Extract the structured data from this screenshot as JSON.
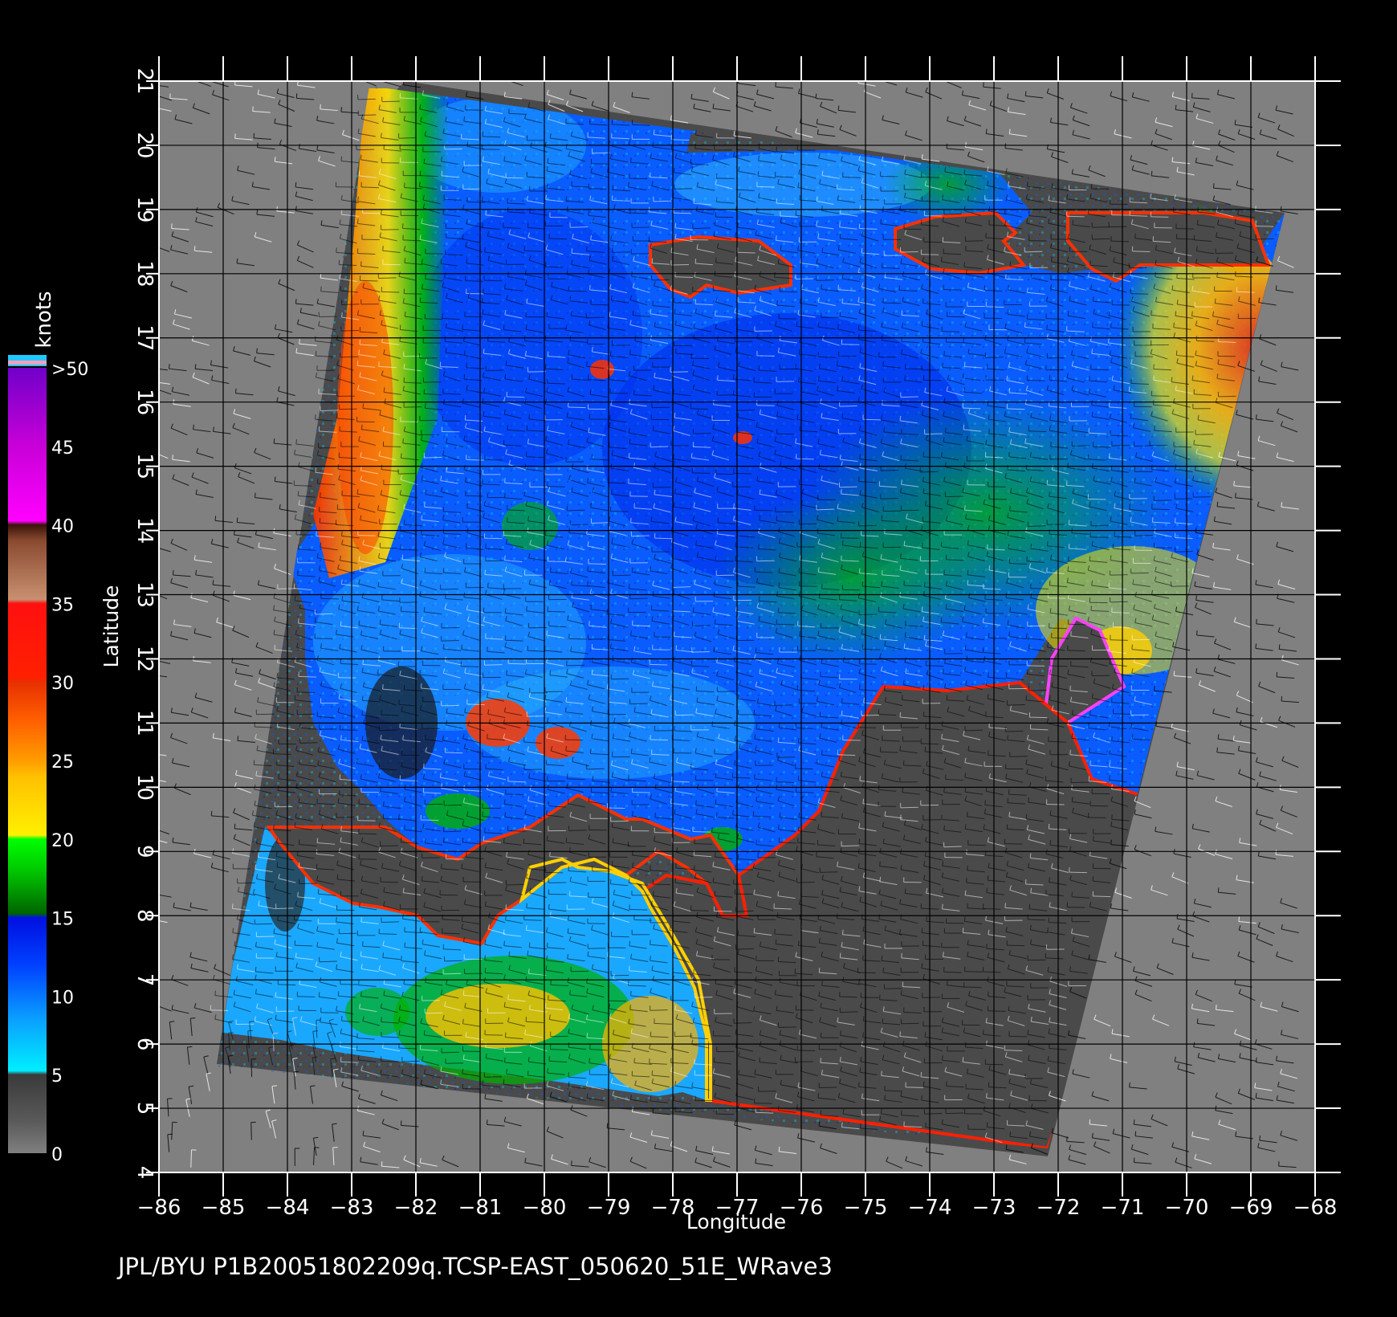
{
  "map": {
    "x_axis": {
      "label": "Longitude",
      "ticks": [
        "-86",
        "-85",
        "-84",
        "-83",
        "-82",
        "-81",
        "-80",
        "-79",
        "-78",
        "-77",
        "-76",
        "-75",
        "-74",
        "-73",
        "-72",
        "-71",
        "-70",
        "-69",
        "-68"
      ],
      "range": [
        -86,
        -68
      ]
    },
    "y_axis": {
      "label": "Latitude",
      "ticks": [
        "4",
        "5",
        "6",
        "7",
        "8",
        "9",
        "10",
        "11",
        "12",
        "13",
        "14",
        "15",
        "16",
        "17",
        "18",
        "19",
        "20",
        "21"
      ],
      "range": [
        4,
        21
      ]
    },
    "grid": true,
    "colorbar": {
      "title": "knots",
      "labels": [
        "0",
        "5",
        "10",
        "15",
        "20",
        "25",
        "30",
        "35",
        "40",
        "45",
        ">50"
      ],
      "colors": [
        "#7a7a7a",
        "#3c3c3c",
        "#00e8ff",
        "#0a8cff",
        "#0030ff",
        "#007a00",
        "#00ee00",
        "#ffee00",
        "#ffb400",
        "#ff7000",
        "#ee2a00",
        "#ff2000",
        "#c88060",
        "#5a2a10",
        "#ff00ff",
        "#b400c8",
        "#7800c8"
      ]
    },
    "colors": {
      "background": "#000000",
      "swath_shadow": "#4a4a4a",
      "outside_swath": "#808080",
      "grid": "#000000"
    }
  },
  "footer": {
    "caption": "JPL/BYU  P1B20051802209q.TCSP-EAST_050620_51E_WRave3"
  }
}
